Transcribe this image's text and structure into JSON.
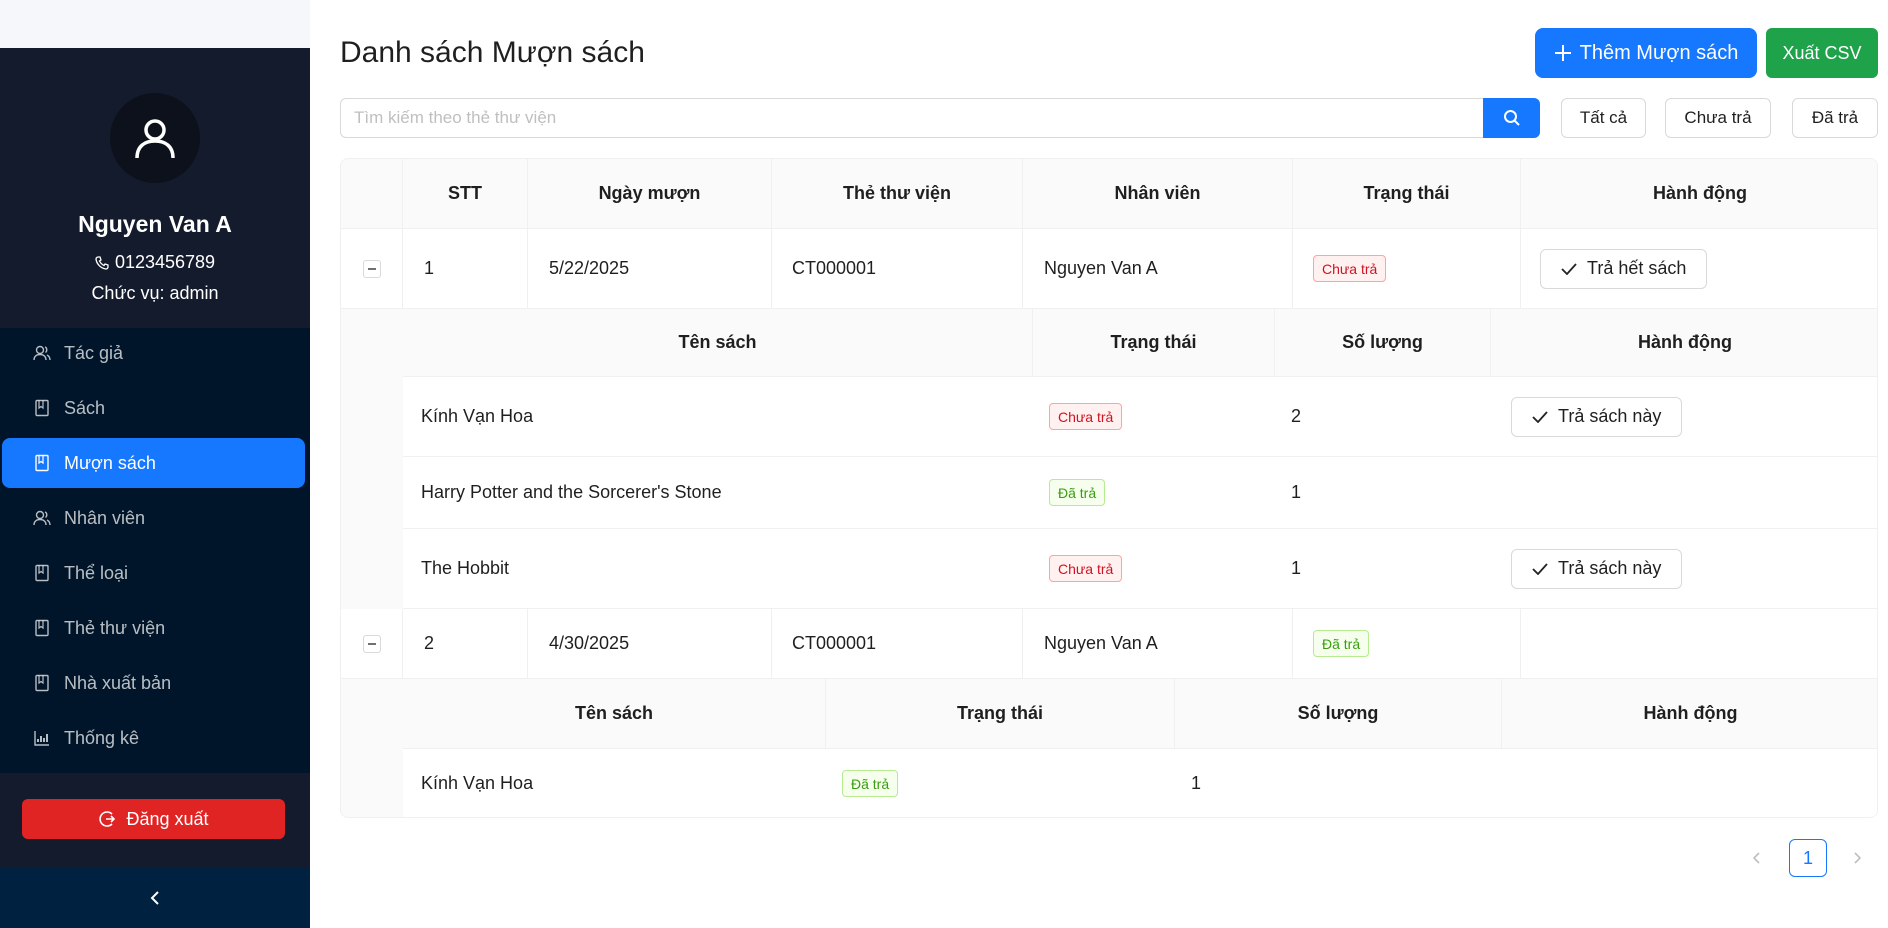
{
  "user": {
    "name": "Nguyen Van A",
    "phone": "0123456789",
    "role": "Chức vụ: admin"
  },
  "menu": [
    {
      "label": "Tác giả",
      "icon": "users-icon"
    },
    {
      "label": "Sách",
      "icon": "book-icon"
    },
    {
      "label": "Mượn sách",
      "icon": "book-icon",
      "active": true
    },
    {
      "label": "Nhân viên",
      "icon": "users-icon"
    },
    {
      "label": "Thể loại",
      "icon": "book-icon"
    },
    {
      "label": "Thẻ thư viện",
      "icon": "book-icon"
    },
    {
      "label": "Nhà xuất bản",
      "icon": "book-icon"
    },
    {
      "label": "Thống kê",
      "icon": "chart-icon"
    }
  ],
  "logout_label": "Đăng xuất",
  "page": {
    "title": "Danh sách Mượn sách",
    "add_label": "Thêm Mượn sách",
    "csv_label": "Xuất CSV",
    "search_placeholder": "Tìm kiếm theo thẻ thư viện",
    "filters": [
      "Tất cả",
      "Chưa trả",
      "Đã trả"
    ]
  },
  "table": {
    "headers": [
      "STT",
      "Ngày mượn",
      "Thẻ thư viện",
      "Nhân viên",
      "Trạng thái",
      "Hành động"
    ],
    "nested_headers": [
      "Tên sách",
      "Trạng thái",
      "Số lượng",
      "Hành động"
    ],
    "rows": [
      {
        "stt": "1",
        "date": "5/22/2025",
        "card": "CT000001",
        "staff": "Nguyen Van A",
        "status": "Chưa trả",
        "action": "Trả hết sách",
        "books": [
          {
            "name": "Kính Vạn Hoa",
            "status": "Chưa trả",
            "qty": "2",
            "action": "Trả sách này"
          },
          {
            "name": "Harry Potter and the Sorcerer's Stone",
            "status": "Đã trả",
            "qty": "1",
            "action": ""
          },
          {
            "name": "The Hobbit",
            "status": "Chưa trả",
            "qty": "1",
            "action": "Trả sách này"
          }
        ]
      },
      {
        "stt": "2",
        "date": "4/30/2025",
        "card": "CT000001",
        "staff": "Nguyen Van A",
        "status": "Đã trả",
        "action": "",
        "books": [
          {
            "name": "Kính Vạn Hoa",
            "status": "Đã trả",
            "qty": "1",
            "action": ""
          }
        ]
      }
    ]
  },
  "pagination": {
    "current": "1"
  },
  "colors": {
    "primary": "#1677ff",
    "sidebar": "#001529",
    "danger": "#e02424",
    "success": "#1ea34a"
  }
}
